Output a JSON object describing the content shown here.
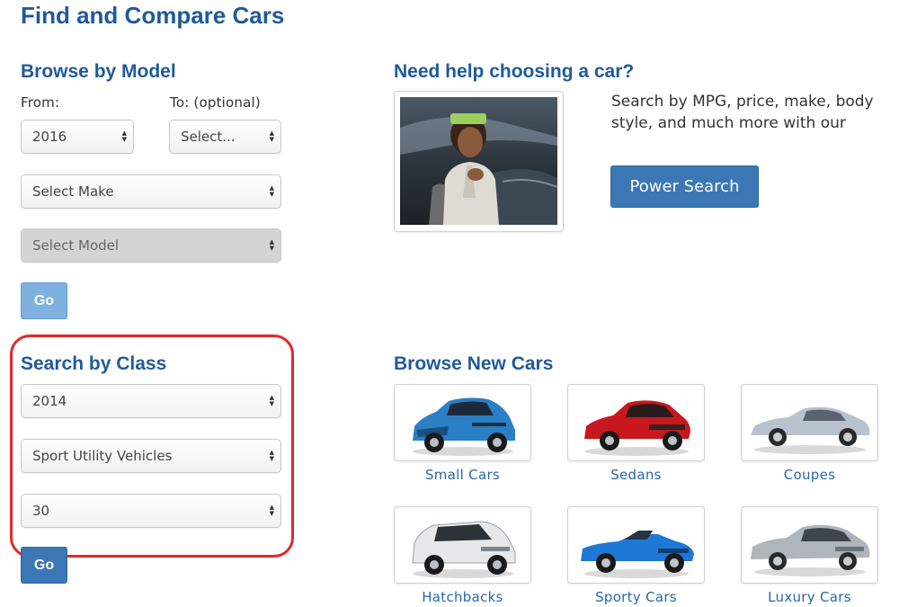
{
  "page_title": "Find and Compare Cars",
  "browse_by_model": {
    "heading": "Browse by Model",
    "from_label": "From:",
    "to_label": "To: (optional)",
    "from_value": "2016",
    "to_value": "Select...",
    "make_value": "Select Make",
    "model_value": "Select Model",
    "go_label": "Go"
  },
  "help": {
    "heading": "Need help choosing a car?",
    "text": "Search by MPG, price, make, body style, and much more with our",
    "button_label": "Power Search"
  },
  "search_by_class": {
    "heading": "Search by Class",
    "year_value": "2014",
    "class_value": "Sport Utility Vehicles",
    "mpg_value": "30",
    "go_label": "Go",
    "highlight_color": "#e02a27"
  },
  "browse_new": {
    "heading": "Browse New Cars",
    "items": [
      {
        "label": "Small Cars",
        "icon": "blue-hatchback-car-icon",
        "color": "#2b7fc4"
      },
      {
        "label": "Sedans",
        "icon": "red-sedan-car-icon",
        "color": "#c8171d"
      },
      {
        "label": "Coupes",
        "icon": "silver-coupe-car-icon",
        "color": "#b9c3cf"
      },
      {
        "label": "Hatchbacks",
        "icon": "white-hatchback-car-icon",
        "color": "#e6e8ea"
      },
      {
        "label": "Sporty Cars",
        "icon": "blue-convertible-car-icon",
        "color": "#1e78d6"
      },
      {
        "label": "Luxury Cars",
        "icon": "silver-luxury-sedan-car-icon",
        "color": "#aeb5bb"
      }
    ]
  },
  "colors": {
    "heading_blue": "#1f5a9b",
    "link_blue": "#2a67a6",
    "button_blue": "#3a77b4",
    "button_disabled_blue": "#7fb1e0"
  }
}
